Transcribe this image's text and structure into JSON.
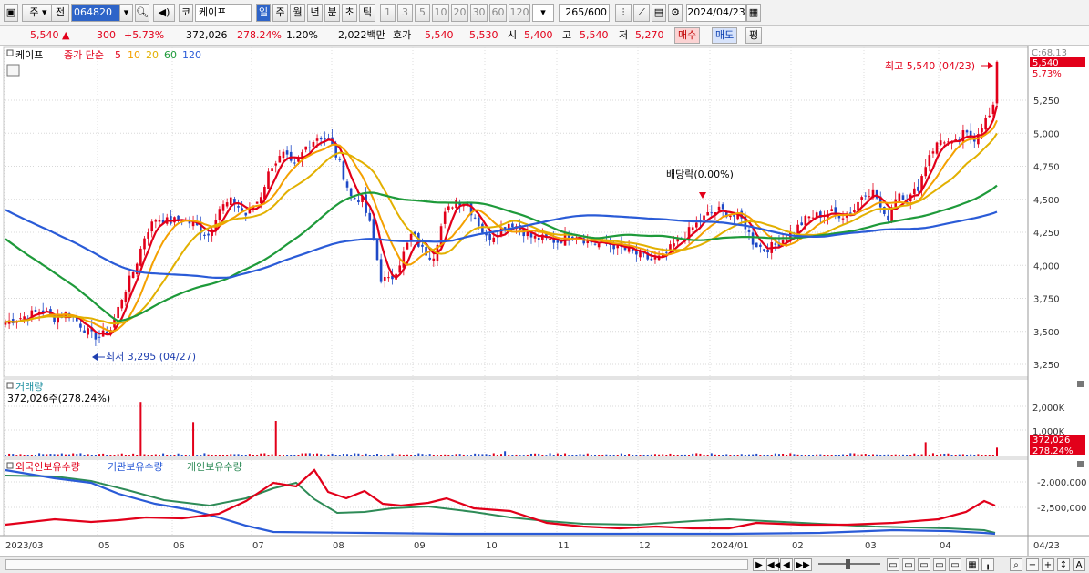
{
  "toolbar": {
    "period_main": "주",
    "prev_label": "전",
    "code": "064820",
    "market": "코",
    "name": "케이프",
    "periods": [
      "일",
      "주",
      "월",
      "년",
      "분",
      "초",
      "틱"
    ],
    "active_period": "일",
    "intervals": [
      "1",
      "3",
      "5",
      "10",
      "20",
      "30",
      "60",
      "120"
    ],
    "count": "265",
    "count_total": "/600",
    "date": "2024/04/23"
  },
  "info": {
    "price": "5,540",
    "arrow": "▲",
    "change": "300",
    "change_pct": "+5.73%",
    "volume": "372,026",
    "volume_ratio": "278.24%",
    "turnover": "1.20%",
    "amount": "2,022백만",
    "quote_label": "호가",
    "ask": "5,540",
    "bid": "5,530",
    "open_label": "시",
    "open": "5,400",
    "high_label": "고",
    "high": "5,540",
    "low_label": "저",
    "low": "5,270",
    "buy_label": "매수",
    "sell_label": "매도",
    "eval_label": "평"
  },
  "price_panel": {
    "stock_tab": "케이프",
    "legend_prefix": "종가 단순",
    "ma_labels": [
      "5",
      "10",
      "20",
      "60",
      "120"
    ],
    "ma_colors": [
      "#e2001a",
      "#f4a000",
      "#e2b000",
      "#1e9a3a",
      "#2a5bd7"
    ],
    "y_ticks": [
      "5,250",
      "5,000",
      "4,750",
      "4,500",
      "4,250",
      "4,000",
      "3,750",
      "3,500",
      "3,250"
    ],
    "top_axis_label": "C:68.13",
    "current_price_tag": "5,540",
    "current_pct_tag": "5.73%",
    "high_annotation": "최고 5,540 (04/23)",
    "low_annotation": "최저 3,295 (04/27)",
    "dividend_annotation": "배당락(0.00%)"
  },
  "volume_panel": {
    "title": "거래량",
    "value": "372,026주(278.24%)",
    "y_ticks": [
      "2,000K",
      "1,000K"
    ],
    "current_tag": "372,026",
    "current_pct_tag": "278.24%"
  },
  "holdings_panel": {
    "series": [
      "외국인보유수량",
      "기관보유수량",
      "개인보유수량"
    ],
    "colors": [
      "#e2001a",
      "#2a5bd7",
      "#2e8b57"
    ],
    "y_ticks": [
      "-2,000,000",
      "-2,500,000"
    ]
  },
  "x_axis": {
    "labels": [
      "2023/03",
      "05",
      "06",
      "07",
      "08",
      "09",
      "10",
      "11",
      "12",
      "2024/01",
      "02",
      "03",
      "04"
    ],
    "end_label": "04/23"
  },
  "bottom_nav": {
    "buttons": [
      "▶",
      "◀◀",
      "◀",
      "▶▶"
    ],
    "zoom_out": "−",
    "zoom_in": "+",
    "reset": "A"
  }
}
